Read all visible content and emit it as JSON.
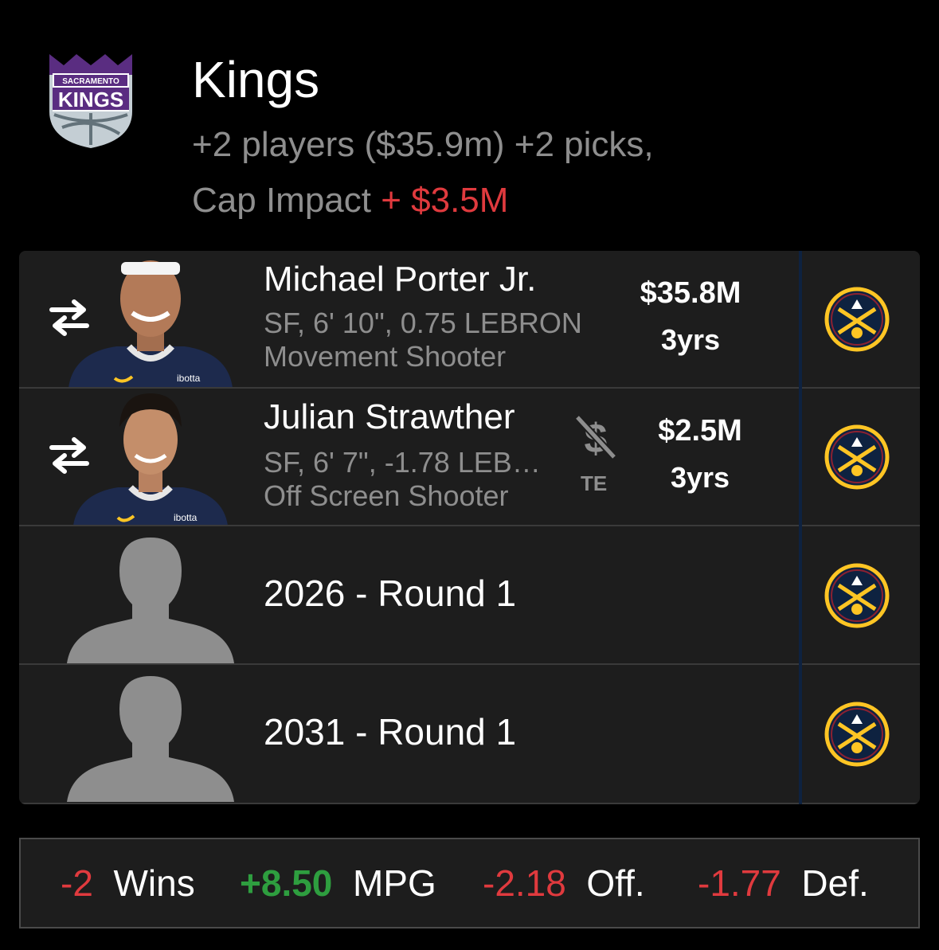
{
  "header": {
    "team_name": "Kings",
    "logo_icon": "sacramento-kings-logo",
    "logo_text_top": "SACRAMENTO",
    "logo_text_main": "KINGS",
    "summary": "+2 players ($35.9m) +2 picks,",
    "cap_label": "Cap Impact ",
    "cap_value": "+ $3.5M"
  },
  "players": [
    {
      "name": "Michael Porter Jr.",
      "line1": "SF, 6' 10\", 0.75 LEBRON",
      "line2": "Movement Shooter",
      "salary": "$35.8M",
      "years": "3yrs",
      "icon": "swap-arrows-icon",
      "team_icon": "denver-nuggets-logo",
      "jersey_text": "ibotta"
    },
    {
      "name": "Julian Strawther",
      "line1": "SF, 6' 7\", -1.78 LEB…",
      "line2": "Off Screen Shooter",
      "salary": "$2.5M",
      "years": "3yrs",
      "icon": "swap-arrows-icon",
      "te_icon": "no-dollar-icon",
      "te_label": "TE",
      "team_icon": "denver-nuggets-logo",
      "jersey_text": "ibotta"
    }
  ],
  "picks": [
    {
      "label": "2026 - Round 1",
      "team_icon": "denver-nuggets-logo"
    },
    {
      "label": "2031 - Round 1",
      "team_icon": "denver-nuggets-logo"
    }
  ],
  "stats": {
    "wins_value": "-2",
    "wins_label": "Wins",
    "mpg_value": "+8.50",
    "mpg_label": "MPG",
    "off_value": "-2.18",
    "off_label": "Off.",
    "def_value": "-1.77",
    "def_label": "Def."
  },
  "colors": {
    "background": "#000000",
    "row_bg": "#1d1d1d",
    "muted_text": "#8e8e8e",
    "negative": "#e03a3e",
    "positive": "#2e9e3f",
    "kings_purple": "#5a2d81",
    "nuggets_navy": "#0e2240",
    "nuggets_gold": "#fec524"
  }
}
